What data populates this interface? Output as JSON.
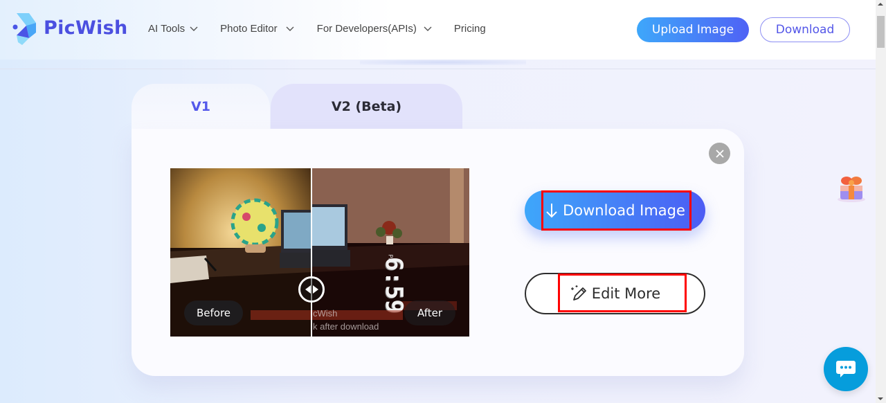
{
  "header": {
    "brand": "PicWish",
    "nav": [
      {
        "label": "AI Tools",
        "has_dropdown": true
      },
      {
        "label": "Photo Editor",
        "has_dropdown": true
      },
      {
        "label": "For Developers(APIs)",
        "has_dropdown": true
      },
      {
        "label": "Pricing",
        "has_dropdown": false
      }
    ],
    "upload_label": "Upload Image",
    "download_label": "Download"
  },
  "tabs": [
    {
      "label": "V1",
      "active": true
    },
    {
      "label": "V2 (Beta)",
      "active": false
    }
  ],
  "preview": {
    "before_label": "Before",
    "after_label": "After",
    "watermark_line1": "cWish",
    "watermark_line2": "k after download",
    "clock_text": "6:59",
    "clock_suffix": "PM"
  },
  "actions": {
    "download_image_label": "Download Image",
    "edit_more_label": "Edit More"
  },
  "icons": {
    "close": "close-icon",
    "download": "arrow-down-icon",
    "edit": "magic-pen-icon",
    "gift": "gift-icon",
    "chat": "chat-bubble-icon",
    "compare_handle": "left-right-arrows-icon"
  },
  "colors": {
    "brand": "#4b4fe0",
    "accent_start": "#3ea7fa",
    "accent_end": "#4f62f5",
    "highlight": "#ff0000",
    "chat": "#069ddc"
  }
}
